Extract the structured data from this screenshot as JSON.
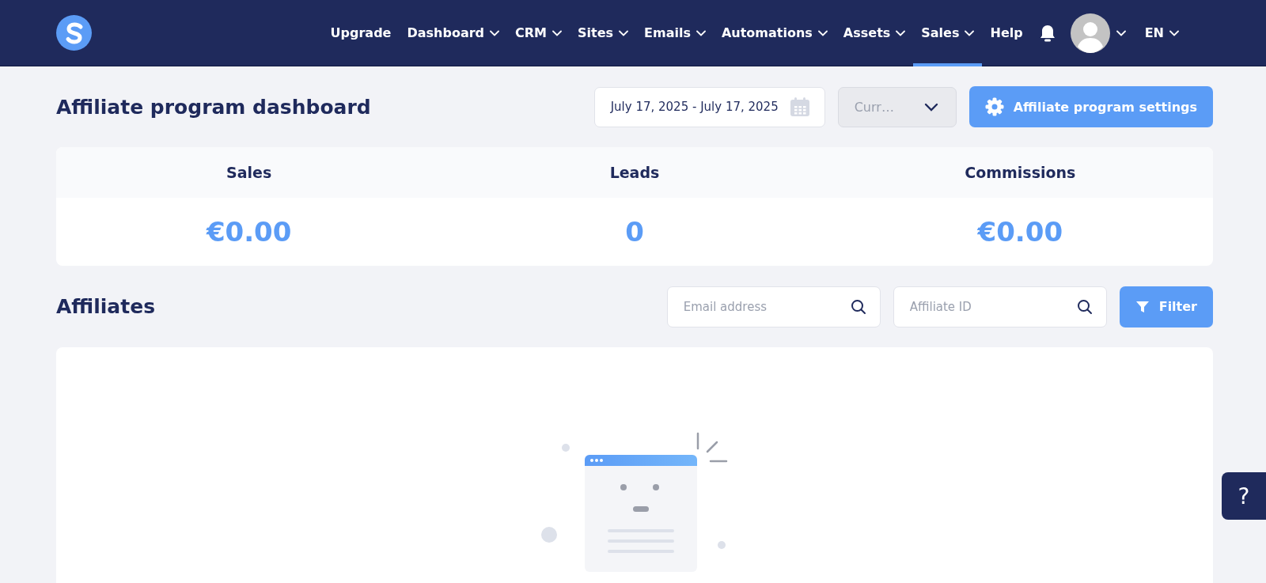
{
  "nav": {
    "items": [
      {
        "label": "Upgrade",
        "dropdown": false,
        "selected": false
      },
      {
        "label": "Dashboard",
        "dropdown": true,
        "selected": false
      },
      {
        "label": "CRM",
        "dropdown": true,
        "selected": false
      },
      {
        "label": "Sites",
        "dropdown": true,
        "selected": false
      },
      {
        "label": "Emails",
        "dropdown": true,
        "selected": false
      },
      {
        "label": "Automations",
        "dropdown": true,
        "selected": false
      },
      {
        "label": "Assets",
        "dropdown": true,
        "selected": false
      },
      {
        "label": "Sales",
        "dropdown": true,
        "selected": true
      },
      {
        "label": "Help",
        "dropdown": false,
        "selected": false
      }
    ],
    "language": "EN"
  },
  "header": {
    "title": "Affiliate program dashboard",
    "date_range": "July 17, 2025 - July 17, 2025",
    "currency_placeholder": "Curr…",
    "settings_button": "Affiliate program settings"
  },
  "stats": [
    {
      "label": "Sales",
      "value": "€0.00"
    },
    {
      "label": "Leads",
      "value": "0"
    },
    {
      "label": "Commissions",
      "value": "€0.00"
    }
  ],
  "affiliates": {
    "title": "Affiliates",
    "email_placeholder": "Email address",
    "id_placeholder": "Affiliate ID",
    "filter_button": "Filter"
  },
  "help_button": "?"
}
